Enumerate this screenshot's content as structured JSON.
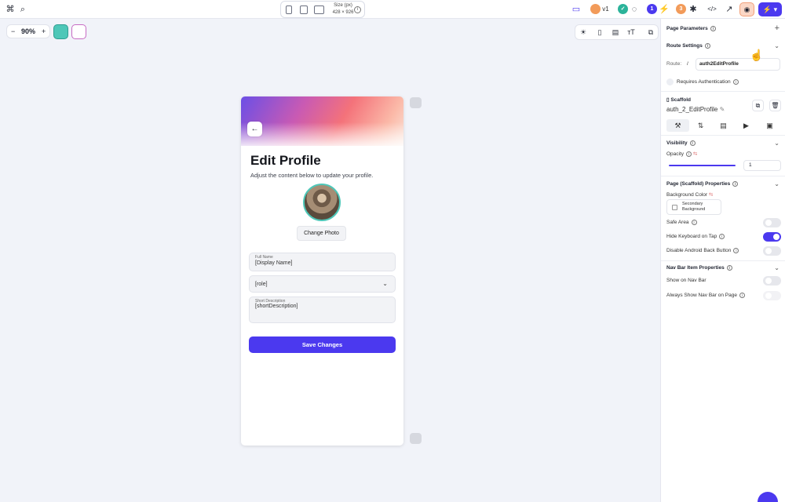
{
  "topbar": {
    "command_icon": "⌘",
    "search_icon": "⌕",
    "size_label": "Size (px)",
    "size_value": "428 × 926",
    "version": "v1",
    "branch_count": "1",
    "warning_count": "3",
    "code_icon": "</>"
  },
  "canvas": {
    "zoom_minus": "−",
    "zoom_value": "90%",
    "zoom_plus": "+"
  },
  "phone": {
    "back_icon": "←",
    "title": "Edit Profile",
    "subtitle": "Adjust the content below to update your profile.",
    "change_photo": "Change Photo",
    "full_name_label": "Full Name",
    "full_name_value": "[Display Name]",
    "role_value": "[role]",
    "short_desc_label": "Short Description",
    "short_desc_value": "[shortDescription]",
    "save_button": "Save Changes"
  },
  "panel": {
    "page_parameters": "Page Parameters",
    "route_settings": "Route Settings",
    "route_label": "Route:",
    "route_slash": "/",
    "route_value": "auth2EditProfile",
    "requires_auth": "Requires Authentication",
    "scaffold_label": "Scaffold",
    "scaffold_name": "auth_2_EditProfile",
    "visibility": "Visibility",
    "opacity": "Opacity",
    "opacity_value": "1",
    "page_props": "Page (Scaffold) Properties",
    "background_color": "Background Color",
    "secondary_background": "Secondary Background",
    "safe_area": "Safe Area",
    "hide_keyboard": "Hide Keyboard on Tap",
    "disable_back": "Disable Android Back Button",
    "nav_bar_props": "Nav Bar Item Properties",
    "show_on_nav": "Show on Nav Bar",
    "always_show_nav": "Always Show Nav Bar on Page"
  },
  "colors": {
    "accent": "#4b39ef",
    "teal": "#4ec7b8"
  }
}
